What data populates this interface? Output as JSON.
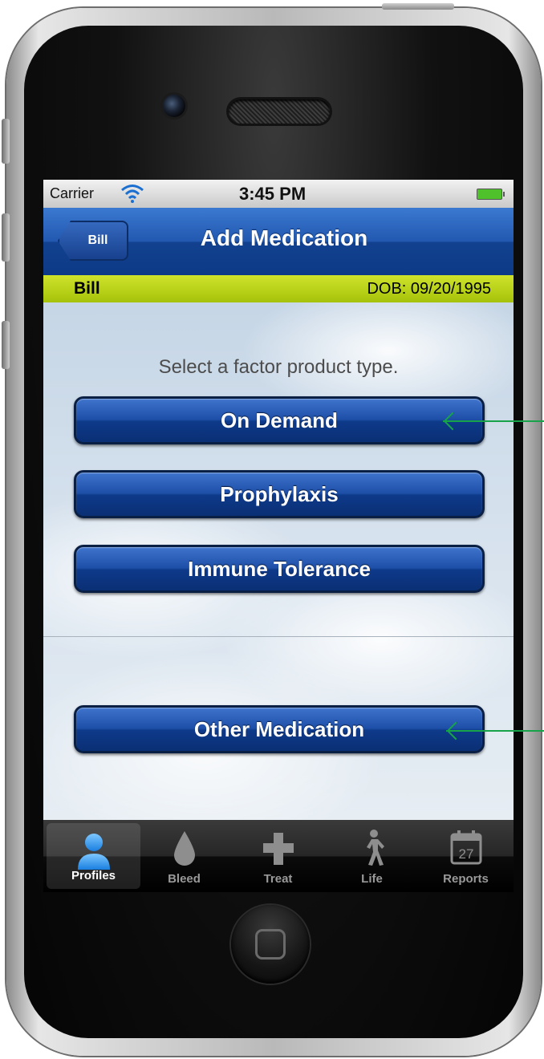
{
  "status_bar": {
    "carrier": "Carrier",
    "time": "3:45 PM"
  },
  "nav_bar": {
    "back_label": "Bill",
    "title": "Add Medication"
  },
  "profile_bar": {
    "name": "Bill",
    "dob": "DOB: 09/20/1995"
  },
  "content": {
    "prompt": "Select a factor product type.",
    "buttons": [
      {
        "label": "On Demand"
      },
      {
        "label": "Prophylaxis"
      },
      {
        "label": "Immune Tolerance"
      }
    ],
    "other_button": {
      "label": "Other Medication"
    }
  },
  "tab_bar": {
    "tabs": [
      {
        "label": "Profiles",
        "icon": "person-icon",
        "active": true
      },
      {
        "label": "Bleed",
        "icon": "drop-icon",
        "active": false
      },
      {
        "label": "Treat",
        "icon": "cross-icon",
        "active": false
      },
      {
        "label": "Life",
        "icon": "walking-person-icon",
        "active": false
      },
      {
        "label": "Reports",
        "icon": "calendar-icon",
        "active": false,
        "icon_text": "27"
      }
    ]
  },
  "colors": {
    "nav_blue": "#2258b0",
    "profile_bar_green": "#bcd61a",
    "annotation_arrow": "#16a34a"
  }
}
